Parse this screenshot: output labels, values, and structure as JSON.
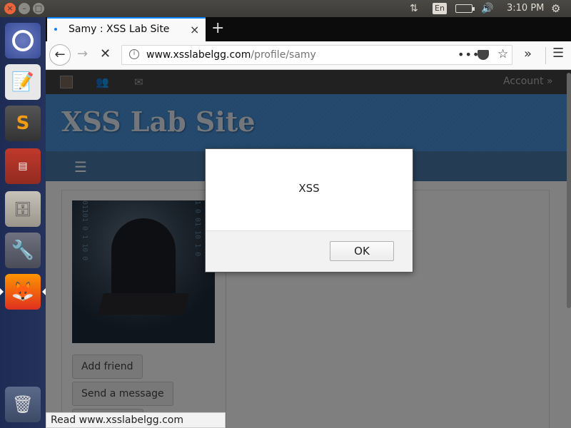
{
  "top_panel": {
    "close": "×",
    "minimize": "–",
    "maximize": "□",
    "network": "⇅",
    "language": "En",
    "volume": "🔊",
    "clock": "3:10 PM",
    "settings": "⚙"
  },
  "launcher": {
    "editor": "📝",
    "sublime": "S",
    "terminal": "▤",
    "files": "🗄",
    "settings": "🔧",
    "firefox": "🦊",
    "trash": "🗑"
  },
  "browser": {
    "tab_title": "Samy : XSS Lab Site",
    "tab_close": "×",
    "new_tab": "+",
    "back": "←",
    "forward": "→",
    "stop": "✕",
    "url_host": "www.xsslabelgg.com",
    "url_path": "/profile/samy",
    "url_more": "•••",
    "bookmark": "☆",
    "overflow": "»",
    "menu": "☰",
    "status_text": "Read www.xsslabelgg.com"
  },
  "page": {
    "friends_icon": "👥",
    "mail_icon": "✉",
    "account_label": "Account  »",
    "site_title": "XSS Lab Site",
    "menu_icon": "☰",
    "add_friend": "Add friend",
    "send_message": "Send a message"
  },
  "dialog": {
    "message": "XSS",
    "ok_label": "OK"
  }
}
